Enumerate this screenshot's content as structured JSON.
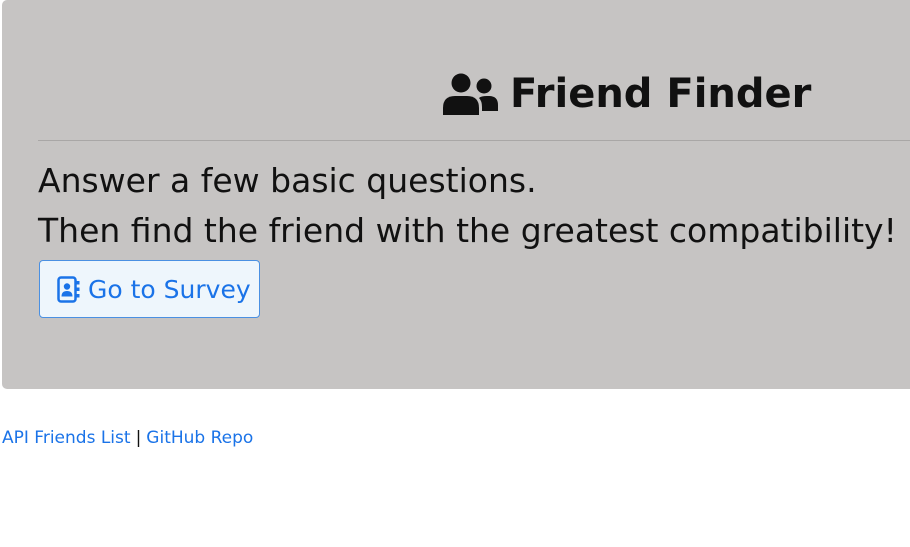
{
  "header": {
    "icon": "user-friends-icon",
    "title": "Friend Finder"
  },
  "intro": {
    "line1": "Answer a few basic questions.",
    "line2": "Then find the friend with the greatest compatibility!"
  },
  "survey_button": {
    "icon": "address-book-icon",
    "label": "Go to Survey"
  },
  "footer": {
    "link1": "API Friends List",
    "separator": "|",
    "link2": "GitHub Repo"
  },
  "colors": {
    "jumbotron_bg": "#c6c4c3",
    "link": "#1a73e8",
    "text": "#111111"
  }
}
